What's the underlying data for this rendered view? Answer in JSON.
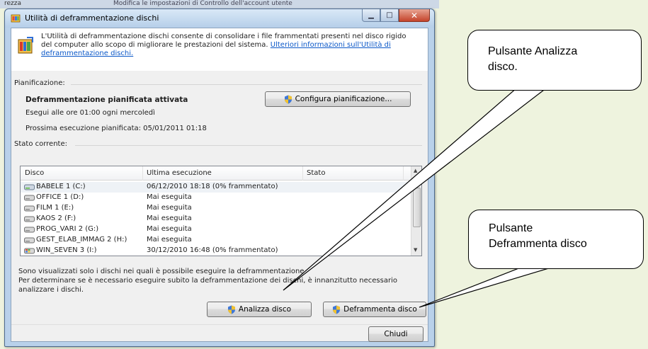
{
  "window": {
    "title": "Utilità di deframmentazione dischi",
    "intro_text": "L'Utilità di deframmentazione dischi consente di consolidare i file frammentati presenti nel disco rigido del computer allo scopo di migliorare le prestazioni del sistema. ",
    "intro_link": "Ulteriori informazioni sull'Utilità di deframmentazione dischi."
  },
  "schedule": {
    "section_label": "Pianificazione:",
    "status": "Deframmentazione pianificata attivata",
    "run_time": "Esegui alle ore 01:00 ogni mercoledì",
    "next_run": "Prossima esecuzione pianificata: 05/01/2011 01:18",
    "configure_button": "Configura pianificazione..."
  },
  "current_status": {
    "section_label": "Stato corrente:",
    "columns": [
      "Disco",
      "Ultima esecuzione",
      "Stato"
    ],
    "rows": [
      {
        "disk": "BABELE 1 (C:)",
        "last_run": "06/12/2010 18:18 (0% frammentato)",
        "status": ""
      },
      {
        "disk": "OFFICE 1 (D:)",
        "last_run": "Mai eseguita",
        "status": ""
      },
      {
        "disk": "FILM 1 (E:)",
        "last_run": "Mai eseguita",
        "status": ""
      },
      {
        "disk": "KAOS 2 (F:)",
        "last_run": "Mai eseguita",
        "status": ""
      },
      {
        "disk": "PROG_VARI 2 (G:)",
        "last_run": "Mai eseguita",
        "status": ""
      },
      {
        "disk": "GEST_ELAB_IMMAG 2 (H:)",
        "last_run": "Mai eseguita",
        "status": ""
      },
      {
        "disk": "WIN_SEVEN 3 (I:)",
        "last_run": "30/12/2010 16:48 (0% frammentato)",
        "status": ""
      }
    ]
  },
  "footer": {
    "note_line1": "Sono visualizzati solo i dischi nei quali è possibile eseguire la deframmentazione.",
    "note_line2": "Per determinare se è necessario eseguire subito la deframmentazione dei dischi, è innanzitutto necessario",
    "note_line3": "analizzare i dischi.",
    "analyze_button": "Analizza disco",
    "defrag_button": "Deframmenta disco",
    "close_button": "Chiudi"
  },
  "callouts": {
    "analyze_line1": "Pulsante Analizza",
    "analyze_line2": "disco.",
    "defrag_line1": "Pulsante",
    "defrag_line2": "Deframmenta disco"
  },
  "background": {
    "left_text": "rezza",
    "strip_text": "Modifica le impostazioni di Controllo dell'account utente"
  },
  "colors": {
    "link": "#0b58c8",
    "close_button": "#c4432a",
    "page_background": "#eef3de"
  },
  "icons": {
    "app": "defrag-icon",
    "shield": "uac-shield-icon",
    "drive": "hard-drive-icon"
  }
}
